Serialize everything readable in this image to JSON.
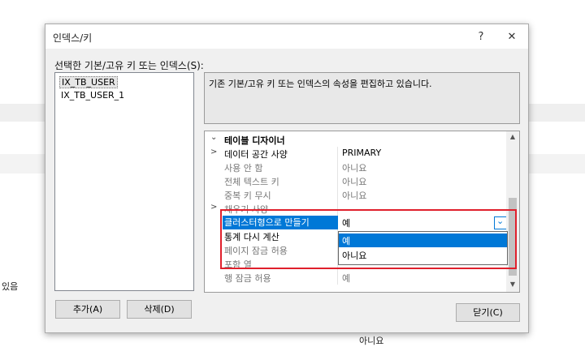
{
  "background": {
    "side_text": "있음",
    "bottom_text": "아니요"
  },
  "dialog": {
    "title": "인덱스/키",
    "help_icon": "?",
    "close_icon": "✕",
    "list_label": "선택한 기본/고유 키 또는 인덱스(S):",
    "list_items": [
      {
        "label": "IX_TB_USER",
        "selected": true
      },
      {
        "label": "IX_TB_USER_1",
        "selected": false
      }
    ],
    "description": "기존 기본/고유 키 또는 인덱스의 속성을 편집하고 있습니다.",
    "property_grid": {
      "category": "테이블 디자이너",
      "rows": [
        {
          "expander": ">",
          "name": "데이터 공간 사양",
          "value": "PRIMARY",
          "dim": false
        },
        {
          "expander": "",
          "name": "사용 안 함",
          "value": "아니요",
          "dim": true
        },
        {
          "expander": "",
          "name": "전체 텍스트 키",
          "value": "아니요",
          "dim": true
        },
        {
          "expander": "",
          "name": "중복 키 무시",
          "value": "아니요",
          "dim": true
        },
        {
          "expander": ">",
          "name": "채우기 사양",
          "value": "",
          "dim": true
        },
        {
          "expander": "",
          "name": "클러스터형으로 만들기",
          "value": "예",
          "dim": false,
          "highlight": true
        },
        {
          "expander": "",
          "name": "통계 다시 계산",
          "value": "",
          "dim": false
        },
        {
          "expander": "",
          "name": "페이지 잠금 허용",
          "value": "",
          "dim": true
        },
        {
          "expander": "",
          "name": "포함 열",
          "value": "",
          "dim": true
        },
        {
          "expander": "",
          "name": "행 잠금 허용",
          "value": "예",
          "dim": true
        }
      ],
      "dropdown_options": [
        {
          "label": "예",
          "selected": true
        },
        {
          "label": "아니요",
          "selected": false
        }
      ]
    },
    "buttons": {
      "add": "추가(A)",
      "delete": "삭제(D)",
      "close": "닫기(C)"
    }
  },
  "colors": {
    "accent": "#0078d7",
    "highlight_box": "#e0202c"
  }
}
